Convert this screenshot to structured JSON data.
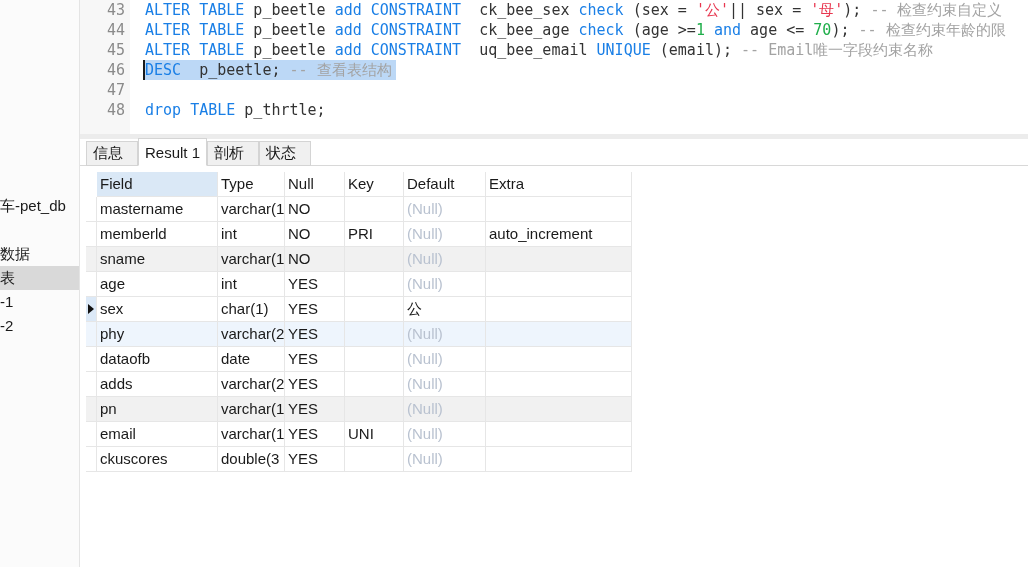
{
  "sidebar": {
    "items": [
      {
        "label": "车-pet_db",
        "selected": false
      },
      {
        "label": "数据",
        "selected": false
      },
      {
        "label": "表",
        "selected": true
      },
      {
        "label": "-1",
        "selected": false
      },
      {
        "label": "-2",
        "selected": false
      }
    ]
  },
  "editor": {
    "lines": [
      {
        "number": "43",
        "selected": false,
        "tokens": [
          {
            "kind": "keyword",
            "text": "ALTER TABLE"
          },
          {
            "kind": "plain",
            "text": " p_beetle "
          },
          {
            "kind": "keyword",
            "text": "add CONSTRAINT"
          },
          {
            "kind": "plain",
            "text": "  ck_bee_sex "
          },
          {
            "kind": "keyword",
            "text": "check"
          },
          {
            "kind": "plain",
            "text": " (sex = "
          },
          {
            "kind": "string",
            "text": "'公'"
          },
          {
            "kind": "plain",
            "text": "|| sex = "
          },
          {
            "kind": "string",
            "text": "'母'"
          },
          {
            "kind": "plain",
            "text": "); "
          },
          {
            "kind": "comment",
            "text": "-- 检查约束自定义"
          }
        ]
      },
      {
        "number": "44",
        "selected": false,
        "tokens": [
          {
            "kind": "keyword",
            "text": "ALTER TABLE"
          },
          {
            "kind": "plain",
            "text": " p_beetle "
          },
          {
            "kind": "keyword",
            "text": "add CONSTRAINT"
          },
          {
            "kind": "plain",
            "text": "  ck_bee_age "
          },
          {
            "kind": "keyword",
            "text": "check"
          },
          {
            "kind": "plain",
            "text": " (age >="
          },
          {
            "kind": "number",
            "text": "1"
          },
          {
            "kind": "keyword",
            "text": " and"
          },
          {
            "kind": "plain",
            "text": " age <= "
          },
          {
            "kind": "number",
            "text": "70"
          },
          {
            "kind": "plain",
            "text": "); "
          },
          {
            "kind": "comment",
            "text": "-- 检查约束年龄的限"
          }
        ]
      },
      {
        "number": "45",
        "selected": false,
        "tokens": [
          {
            "kind": "keyword",
            "text": "ALTER TABLE"
          },
          {
            "kind": "plain",
            "text": " p_beetle "
          },
          {
            "kind": "keyword",
            "text": "add CONSTRAINT"
          },
          {
            "kind": "plain",
            "text": "  uq_bee_email "
          },
          {
            "kind": "keyword",
            "text": "UNIQUE"
          },
          {
            "kind": "plain",
            "text": " (email); "
          },
          {
            "kind": "comment",
            "text": "-- Email唯一字段约束名称"
          }
        ]
      },
      {
        "number": "46",
        "selected": true,
        "tokens": [
          {
            "kind": "keyword",
            "text": "DESC"
          },
          {
            "kind": "plain",
            "text": "  p_beetle; "
          },
          {
            "kind": "comment",
            "text": "-- 查看表结构"
          }
        ]
      },
      {
        "number": "47",
        "selected": false
      },
      {
        "number": "48",
        "selected": false,
        "tokens": [
          {
            "kind": "keyword",
            "text": "drop TABLE"
          },
          {
            "kind": "plain",
            "text": " p_thrtle;"
          }
        ]
      }
    ]
  },
  "result_tabs": [
    {
      "label": "信息",
      "selected": false
    },
    {
      "label": "Result 1",
      "selected": true
    },
    {
      "label": "剖析",
      "selected": false
    },
    {
      "label": "状态",
      "selected": false
    }
  ],
  "table": {
    "columns": [
      {
        "label": "Field",
        "selected": true
      },
      {
        "label": "Type",
        "selected": false
      },
      {
        "label": "Null",
        "selected": false
      },
      {
        "label": "Key",
        "selected": false
      },
      {
        "label": "Default",
        "selected": false
      },
      {
        "label": "Extra",
        "selected": false
      }
    ],
    "rows": [
      {
        "selected": false,
        "hovered": false,
        "shaded": false,
        "field": "mastername",
        "type": "varchar(1",
        "null": "NO",
        "default": "(Null)",
        "default_is_null": true
      },
      {
        "selected": false,
        "hovered": false,
        "shaded": false,
        "field": "memberld",
        "type": "int",
        "null": "NO",
        "key": "PRI",
        "default": "(Null)",
        "default_is_null": true,
        "extra": "auto_increment"
      },
      {
        "selected": false,
        "hovered": false,
        "shaded": true,
        "field": "sname",
        "type": "varchar(1",
        "null": "NO",
        "default": "(Null)",
        "default_is_null": true
      },
      {
        "selected": false,
        "hovered": false,
        "shaded": false,
        "field": "age",
        "type": "int",
        "null": "YES",
        "default": "(Null)",
        "default_is_null": true
      },
      {
        "selected": true,
        "hovered": false,
        "shaded": false,
        "field": "sex",
        "type": "char(1)",
        "null": "YES",
        "default": "公",
        "default_is_null": false
      },
      {
        "selected": false,
        "hovered": true,
        "shaded": false,
        "field": "phy",
        "type": "varchar(2",
        "null": "YES",
        "default": "(Null)",
        "default_is_null": true
      },
      {
        "selected": false,
        "hovered": false,
        "shaded": false,
        "field": "dataofb",
        "type": "date",
        "null": "YES",
        "default": "(Null)",
        "default_is_null": true
      },
      {
        "selected": false,
        "hovered": false,
        "shaded": false,
        "field": "adds",
        "type": "varchar(2",
        "null": "YES",
        "default": "(Null)",
        "default_is_null": true
      },
      {
        "selected": false,
        "hovered": false,
        "shaded": true,
        "field": "pn",
        "type": "varchar(1",
        "null": "YES",
        "default": "(Null)",
        "default_is_null": true
      },
      {
        "selected": false,
        "hovered": false,
        "shaded": false,
        "field": "email",
        "type": "varchar(1",
        "null": "YES",
        "key": "UNI",
        "default": "(Null)",
        "default_is_null": true
      },
      {
        "selected": false,
        "hovered": false,
        "shaded": false,
        "field": "ckuscores",
        "type": "double(3",
        "null": "YES",
        "default": "(Null)",
        "default_is_null": true
      }
    ]
  }
}
